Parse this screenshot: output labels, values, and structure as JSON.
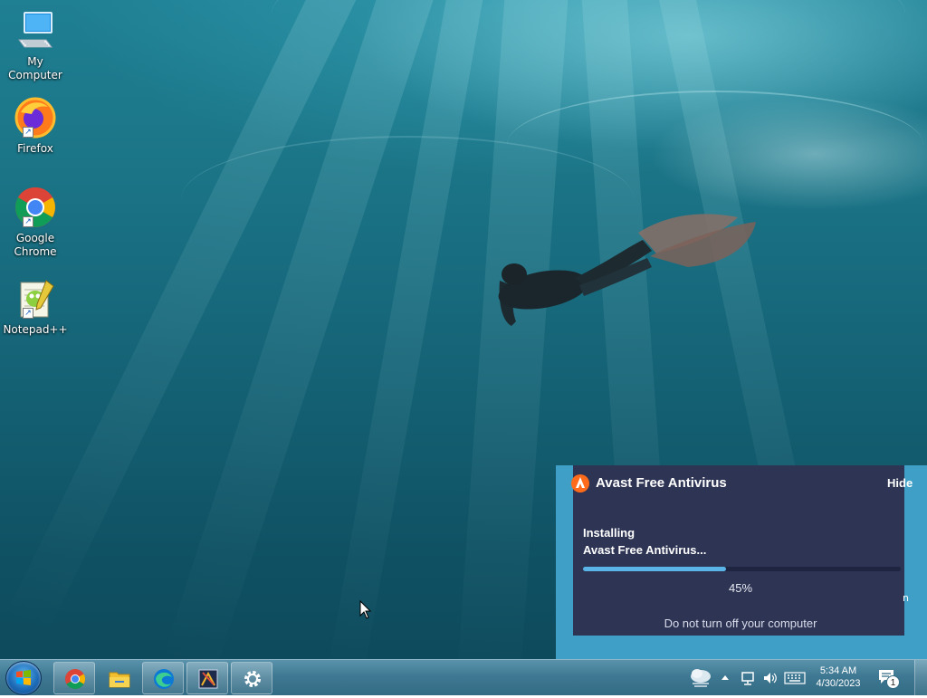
{
  "desktop": {
    "icons": [
      {
        "label": "My Computer",
        "icon": "computer-icon"
      },
      {
        "label": "Firefox",
        "icon": "firefox-icon"
      },
      {
        "label": "Google Chrome",
        "icon": "chrome-icon"
      },
      {
        "label": "Notepad++",
        "icon": "notepadpp-icon"
      }
    ]
  },
  "avast": {
    "title": "Avast Free Antivirus",
    "hide_label": "Hide",
    "status_line1": "Installing",
    "status_line2": "Avast Free Antivirus...",
    "progress_value": 0.45,
    "progress_label": "45%",
    "note": "Do not turn off your computer",
    "overflow_char": "n",
    "colors": {
      "card": "#2d3454",
      "panel": "#3f9fc6",
      "accent": "#5ab4e8",
      "logo": "#ff6b1a"
    }
  },
  "taskbar": {
    "start_icon": "windows-start-icon",
    "pinned": [
      {
        "name": "chrome",
        "icon": "chrome-icon"
      },
      {
        "name": "file-explorer",
        "icon": "folder-icon"
      },
      {
        "name": "edge",
        "icon": "edge-icon"
      },
      {
        "name": "app",
        "icon": "app-window-icon"
      },
      {
        "name": "settings",
        "icon": "gear-icon"
      }
    ],
    "tray": {
      "weather_icon": "weather-cloud-icon",
      "expand_icon": "chevron-up-icon",
      "network_icon": "network-icon",
      "volume_icon": "volume-icon",
      "keyboard_icon": "keyboard-icon",
      "notification_count": "1",
      "time": "5:34 AM",
      "date": "4/30/2023"
    }
  }
}
